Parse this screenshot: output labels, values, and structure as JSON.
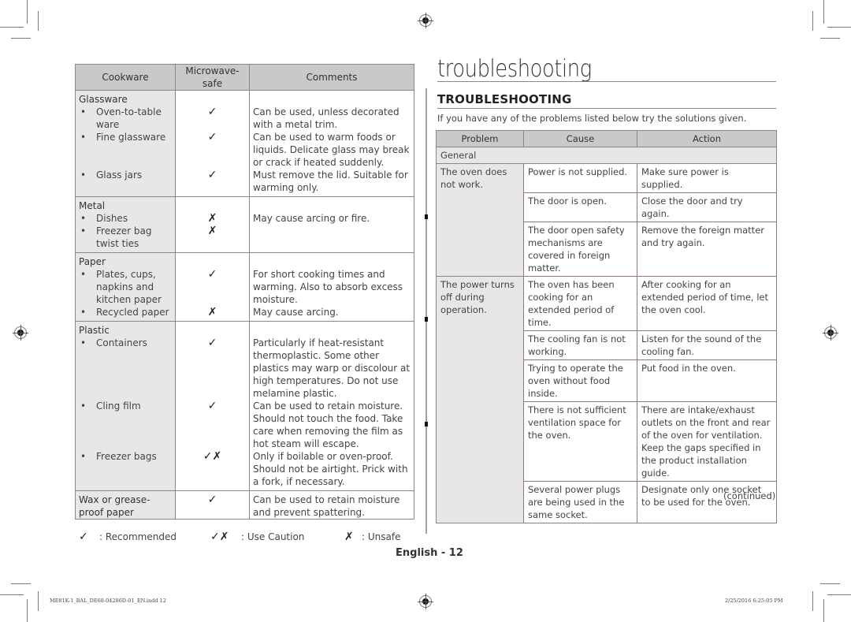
{
  "cookware_table": {
    "headers": [
      "Cookware",
      "Microwave-safe",
      "Comments"
    ],
    "groups": [
      {
        "title": "Glassware",
        "items": [
          {
            "name": "Oven-to-table ware",
            "safe": "✓",
            "comment": "Can be used, unless decorated with a metal trim."
          },
          {
            "name": "Fine glassware",
            "safe": "✓",
            "comment": "Can be used to warm foods or liquids. Delicate glass may break or crack if heated suddenly."
          },
          {
            "name": "Glass jars",
            "safe": "✓",
            "comment": "Must remove the lid. Suitable for warming only."
          }
        ]
      },
      {
        "title": "Metal",
        "items": [
          {
            "name": "Dishes",
            "safe": "✗",
            "comment": "May cause arcing or fire."
          },
          {
            "name": "Freezer bag twist ties",
            "safe": "✗",
            "comment": ""
          }
        ]
      },
      {
        "title": "Paper",
        "items": [
          {
            "name": "Plates, cups, napkins and kitchen paper",
            "safe": "✓",
            "comment": "For short cooking times and warming. Also to absorb excess moisture."
          },
          {
            "name": "Recycled paper",
            "safe": "✗",
            "comment": "May cause arcing."
          }
        ]
      },
      {
        "title": "Plastic",
        "items": [
          {
            "name": "Containers",
            "safe": "✓",
            "comment": "Particularly if heat-resistant thermoplastic. Some other plastics may warp or discolour at high temperatures. Do not use melamine plastic."
          },
          {
            "name": "Cling film",
            "safe": "✓",
            "comment": "Can be used to retain moisture. Should not touch the food. Take care when removing the film as hot steam will escape."
          },
          {
            "name": "Freezer bags",
            "safe": "✓✗",
            "comment": "Only if boilable or oven-proof. Should not be airtight. Prick with a fork, if necessary."
          }
        ]
      }
    ],
    "final_row": {
      "name": "Wax or grease-proof paper",
      "safe": "✓",
      "comment": "Can be used to retain moisture and prevent spattering."
    }
  },
  "legend": {
    "recommended_symbol": "✓",
    "recommended_label": ": Recommended",
    "caution_symbol": "✓✗",
    "caution_label": ": Use Caution",
    "unsafe_symbol": "✗",
    "unsafe_label": ": Unsafe"
  },
  "troubleshooting": {
    "chapter_title": "troubleshooting",
    "section_title": "TROUBLESHOOTING",
    "intro": "If you have any of the problems listed below try the solutions given.",
    "headers": [
      "Problem",
      "Cause",
      "Action"
    ],
    "category": "General",
    "problems": [
      {
        "problem": "The oven does not work.",
        "rows": [
          {
            "cause": "Power is not supplied.",
            "action": "Make sure power is supplied."
          },
          {
            "cause": "The door is open.",
            "action": "Close the door and try again."
          },
          {
            "cause": "The door open safety mechanisms are covered in foreign matter.",
            "action": "Remove the foreign matter and try again."
          }
        ]
      },
      {
        "problem": "The power turns off during operation.",
        "rows": [
          {
            "cause": "The oven has been cooking for an extended period of time.",
            "action": "After cooking for an extended period of time, let the oven cool."
          },
          {
            "cause": "The cooling fan is not working.",
            "action": "Listen for the sound of the cooling fan."
          },
          {
            "cause": "Trying to operate the oven without food inside.",
            "action": "Put food in the oven."
          },
          {
            "cause": "There is not sufficient ventilation space for the oven.",
            "action": "There are intake/exhaust outlets on the front and rear of the oven for ventilation. Keep the gaps specified in the product installation guide."
          },
          {
            "cause": "Several power plugs are being used in the same socket.",
            "action": "Designate only one socket to be used for the oven."
          }
        ]
      }
    ],
    "continued": "(continued)"
  },
  "page_number": "English - 12",
  "footer": {
    "file": "ME81K-1_BAL_DE68-04286D-01_EN.indd   12",
    "date": "2/25/2016   6:25:05 PM"
  }
}
